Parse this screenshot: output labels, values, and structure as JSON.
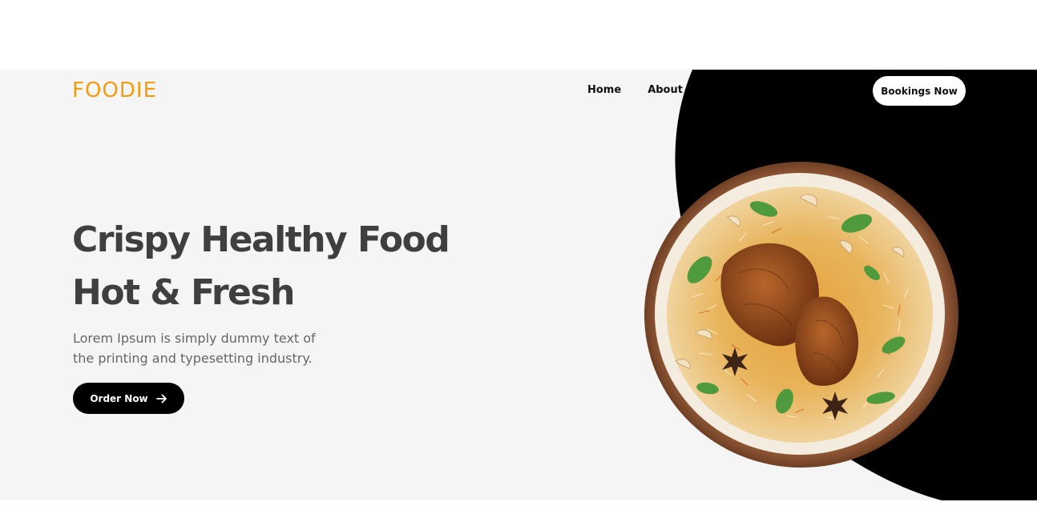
{
  "header": {
    "logo": "FOODIE",
    "nav": [
      "Home",
      "About"
    ],
    "booking_label": "Bookings Now"
  },
  "hero": {
    "title_line1": "Crispy Healthy Food",
    "title_line2": "Hot & Fresh",
    "description": "Lorem Ipsum is simply dummy text of the printing and typesetting industry.",
    "order_label": "Order Now"
  },
  "icons": {
    "order_arrow": "arrow-right-icon",
    "dish": "biryani-plate-image"
  },
  "colors": {
    "accent": "#f39c12",
    "hero_background": "#f5f5f5",
    "heading": "#3f3f3f",
    "body_text": "#666666",
    "dark": "#000000"
  }
}
